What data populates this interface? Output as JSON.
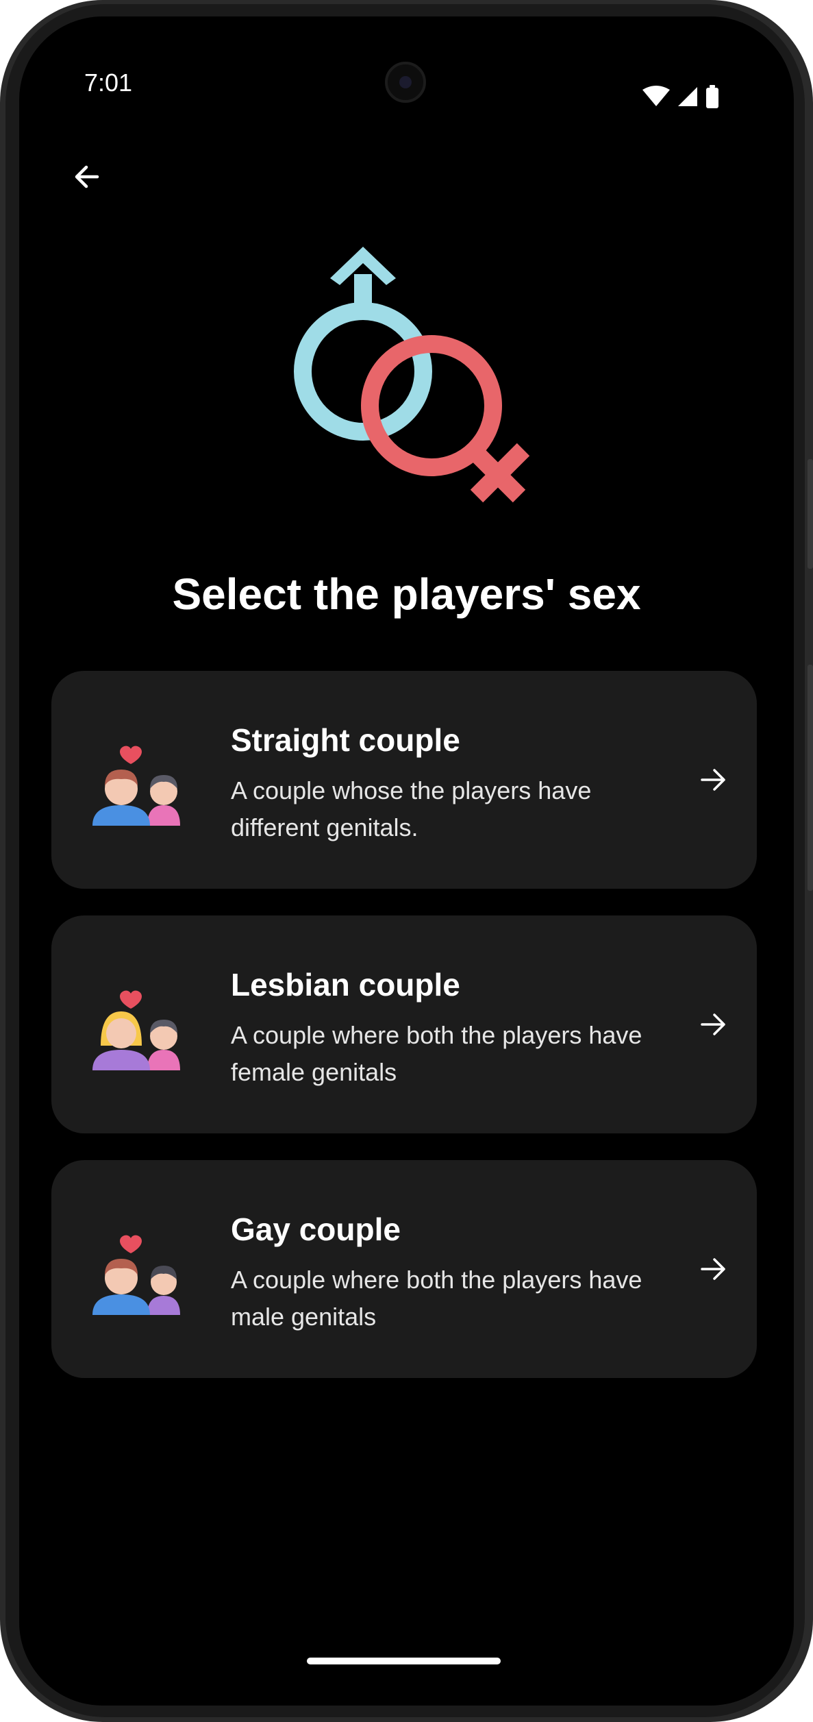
{
  "status_bar": {
    "time": "7:01",
    "icons": [
      "wifi-icon",
      "cellular-signal-icon",
      "battery-icon"
    ]
  },
  "header": {
    "back_icon": "arrow-left-icon"
  },
  "hero": {
    "icon": "male-female-symbols-icon",
    "colors": {
      "male": "#9fdce7",
      "female": "#e8666a"
    }
  },
  "title": "Select the players' sex",
  "options": [
    {
      "title": "Straight couple",
      "description": "A couple whose the players have different genitals.",
      "icon": "straight-couple-icon",
      "arrow_icon": "arrow-right-icon"
    },
    {
      "title": "Lesbian couple",
      "description": "A couple where both the players have female genitals",
      "icon": "lesbian-couple-icon",
      "arrow_icon": "arrow-right-icon"
    },
    {
      "title": "Gay couple",
      "description": "A couple where both the players have male genitals",
      "icon": "gay-couple-icon",
      "arrow_icon": "arrow-right-icon"
    }
  ],
  "theme": {
    "background": "#000000",
    "card": "#1c1c1c",
    "text": "#ffffff",
    "heart": "#e8505f"
  }
}
